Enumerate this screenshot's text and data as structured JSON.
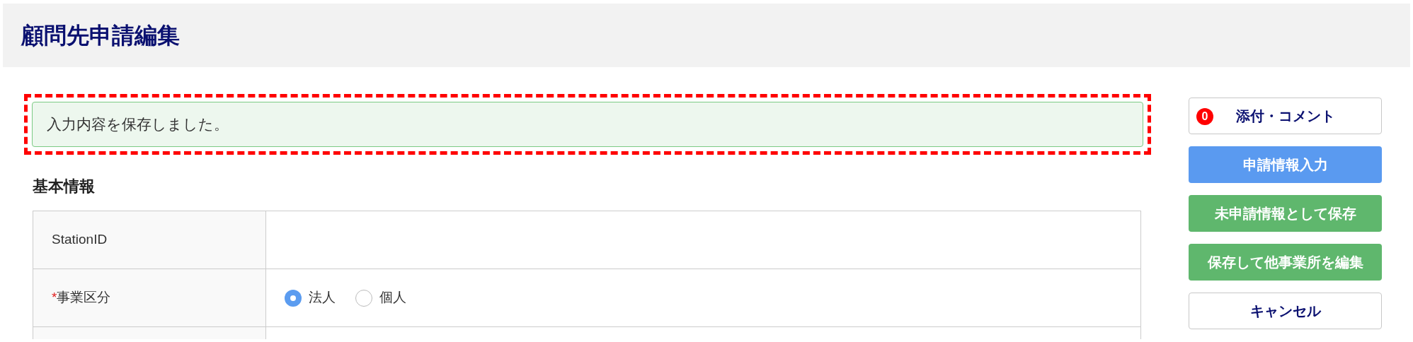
{
  "header": {
    "title": "顧問先申請編集"
  },
  "alert": {
    "message": "入力内容を保存しました。"
  },
  "section": {
    "title": "基本情報"
  },
  "form_rows": [
    {
      "kind": "text",
      "label": "StationID"
    },
    {
      "kind": "radio",
      "label": "事業区分",
      "required_mark": "*",
      "options": [
        {
          "label": "法人",
          "selected": true
        },
        {
          "label": "個人",
          "selected": false
        }
      ]
    },
    {
      "kind": "empty"
    }
  ],
  "buttons": [
    {
      "kind": "outline",
      "label": "添付・コメント",
      "badge": "0"
    },
    {
      "kind": "primary",
      "label": "申請情報入力"
    },
    {
      "kind": "success",
      "label": "未申請情報として保存"
    },
    {
      "kind": "success",
      "label": "保存して他事業所を編集"
    },
    {
      "kind": "outline",
      "label": "キャンセル"
    }
  ]
}
